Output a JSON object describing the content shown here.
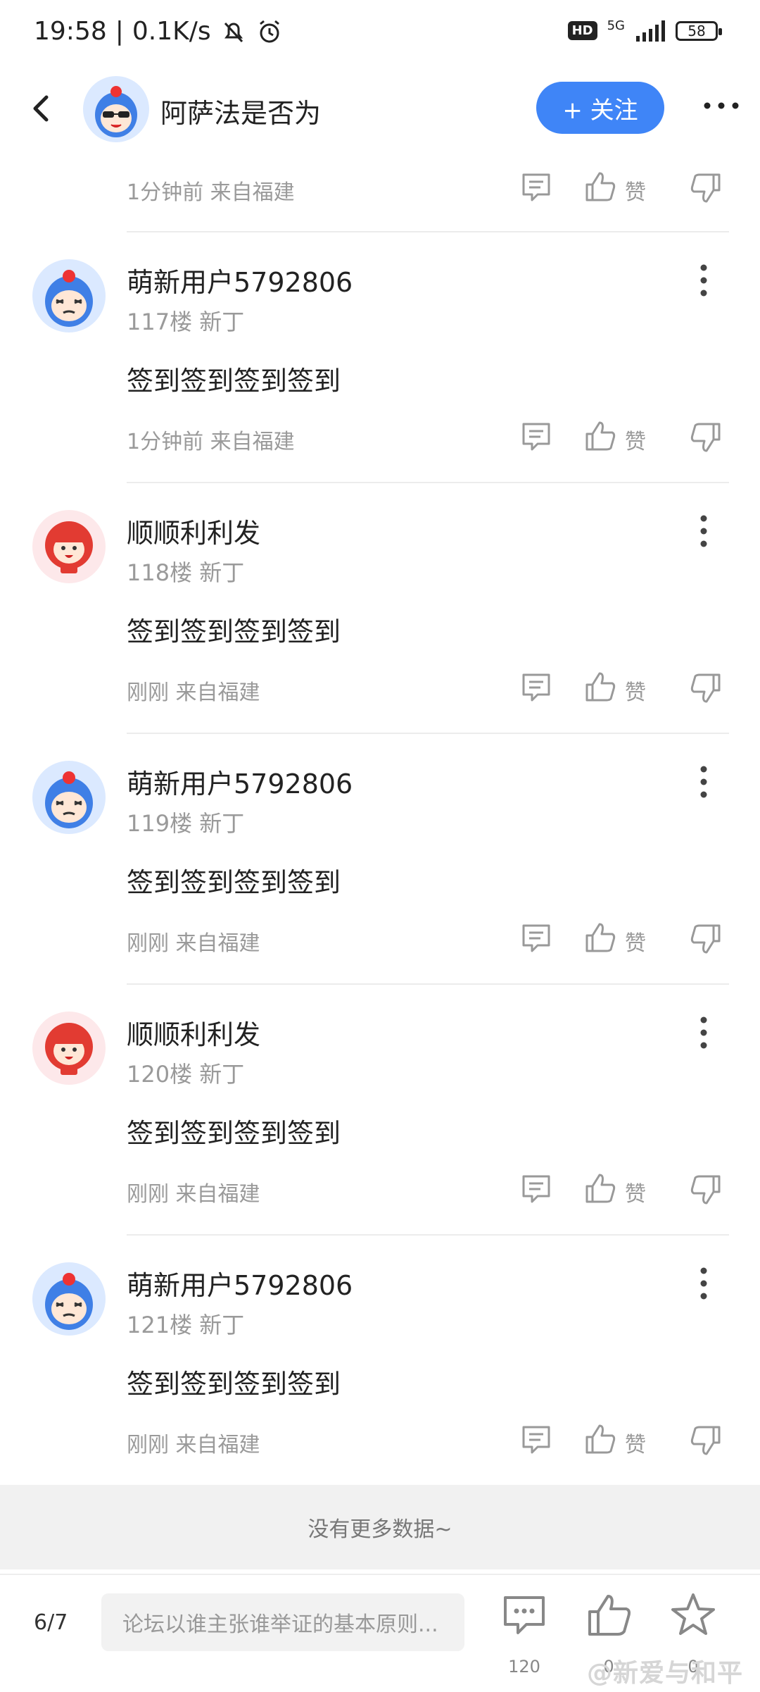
{
  "status": {
    "time": "19:58",
    "speed": "0.1K/s",
    "hd": "HD",
    "network": "5G",
    "battery": "58"
  },
  "header": {
    "name": "阿萨法是否为",
    "follow_label": "+ 关注"
  },
  "first": {
    "meta": "1分钟前 来自福建",
    "like_label": "赞"
  },
  "posts": [
    {
      "username": "萌新用户5792806",
      "floor": "117楼 新丁",
      "content": "签到签到签到签到",
      "meta": "1分钟前 来自福建",
      "like_label": "赞"
    },
    {
      "username": "顺顺利利发",
      "floor": "118楼 新丁",
      "content": "签到签到签到签到",
      "meta": "刚刚 来自福建",
      "like_label": "赞"
    },
    {
      "username": "萌新用户5792806",
      "floor": "119楼 新丁",
      "content": "签到签到签到签到",
      "meta": "刚刚 来自福建",
      "like_label": "赞"
    },
    {
      "username": "顺顺利利发",
      "floor": "120楼 新丁",
      "content": "签到签到签到签到",
      "meta": "刚刚 来自福建",
      "like_label": "赞"
    },
    {
      "username": "萌新用户5792806",
      "floor": "121楼 新丁",
      "content": "签到签到签到签到",
      "meta": "刚刚 来自福建",
      "like_label": "赞"
    }
  ],
  "no_more": "没有更多数据~",
  "bottom": {
    "page": "6/7",
    "placeholder": "论坛以谁主张谁举证的基本原则...",
    "comments": "120",
    "likes": "0",
    "stars": "0",
    "watermark": "@新爱与和平"
  },
  "colors": {
    "accent": "#3f85f7",
    "avatar_blue_bg": "#dbe9ff",
    "avatar_red_bg": "#fde8ea"
  }
}
